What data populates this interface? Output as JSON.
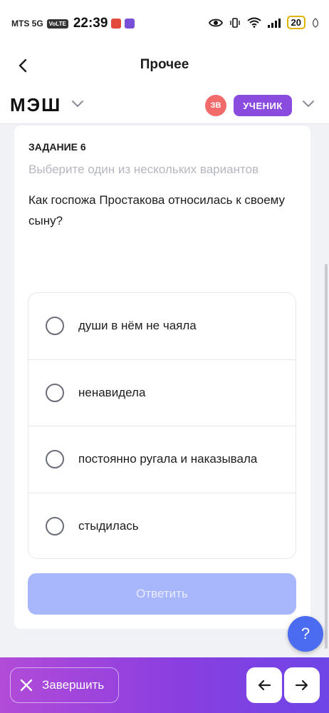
{
  "status_bar": {
    "carrier": "MTS 5G",
    "volte": "VoLTE",
    "time": "22:39",
    "battery": "20"
  },
  "nav": {
    "title": "Прочее"
  },
  "header": {
    "logo": "МЭШ",
    "avatar_initials": "ЗВ",
    "role": "УЧЕНИК"
  },
  "task": {
    "number": "ЗАДАНИЕ 6",
    "hint": "Выберите один из нескольких вариантов",
    "question": "Как госпожа Простакова относилась к своему сыну?",
    "options": [
      {
        "label": "души в нём не чаяла"
      },
      {
        "label": "ненавидела"
      },
      {
        "label": "постоянно ругала и наказывала"
      },
      {
        "label": "стыдилась"
      }
    ],
    "submit_label": "Ответить"
  },
  "help": {
    "label": "?"
  },
  "bottom": {
    "finish_label": "Завершить"
  },
  "colors": {
    "accent": "#4b6cf0",
    "role_badge": "#8a4bdf",
    "avatar": "#f26b6b",
    "submit_disabled": "#a8b6fb"
  }
}
